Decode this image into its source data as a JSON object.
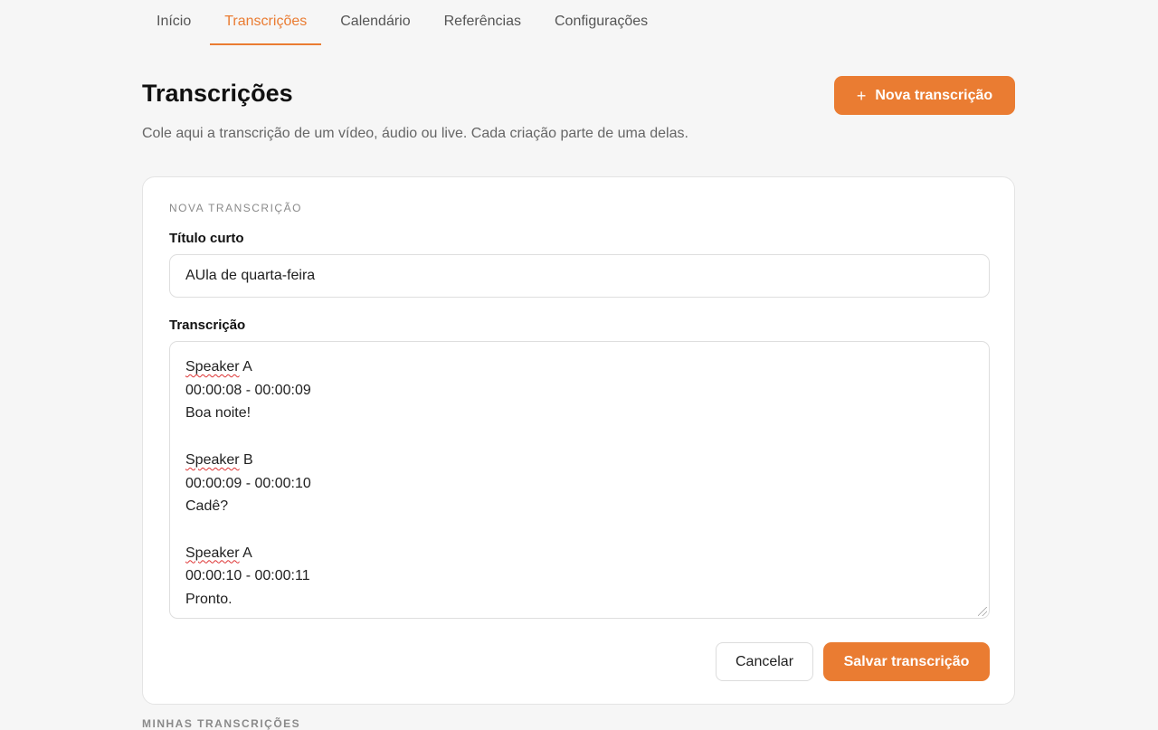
{
  "nav": {
    "tabs": [
      {
        "label": "Início",
        "active": false
      },
      {
        "label": "Transcrições",
        "active": true
      },
      {
        "label": "Calendário",
        "active": false
      },
      {
        "label": "Referências",
        "active": false
      },
      {
        "label": "Configurações",
        "active": false
      }
    ]
  },
  "header": {
    "title": "Transcrições",
    "subtitle": "Cole aqui a transcrição de um vídeo, áudio ou live. Cada criação parte de uma delas.",
    "new_button_icon": "+",
    "new_button_label": "Nova transcrição"
  },
  "form": {
    "section_label": "NOVA TRANSCRIÇÃO",
    "title_label": "Título curto",
    "title_value": "AUla de quarta-feira",
    "transcript_label": "Transcrição",
    "transcript_lines": [
      {
        "text": "Speaker",
        "suffix": " A"
      },
      {
        "text": "00:00:08 - 00:00:09"
      },
      {
        "text": "Boa noite!"
      },
      {
        "text": ""
      },
      {
        "text": "Speaker",
        "suffix": " B"
      },
      {
        "text": "00:00:09 - 00:00:10"
      },
      {
        "text": "Cadê?"
      },
      {
        "text": ""
      },
      {
        "text": "Speaker",
        "suffix": " A"
      },
      {
        "text": "00:00:10 - 00:00:11"
      },
      {
        "text": "Pronto."
      }
    ],
    "cancel_label": "Cancelar",
    "save_label": "Salvar transcrição"
  },
  "list": {
    "heading": "MINHAS TRANSCRIÇÕES"
  },
  "colors": {
    "accent": "#ea7c32",
    "background": "#f6f6f6"
  }
}
